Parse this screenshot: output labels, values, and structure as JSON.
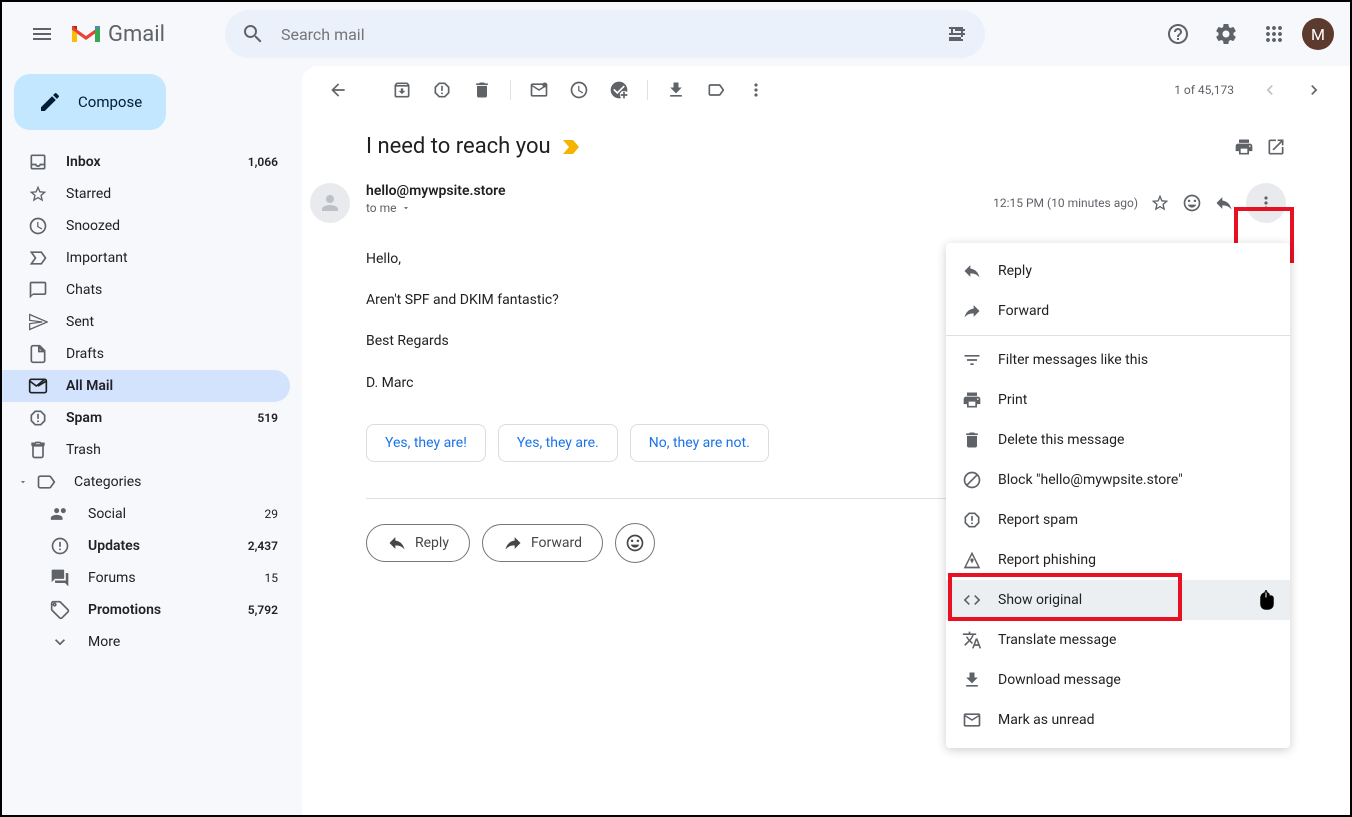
{
  "header": {
    "app_name": "Gmail",
    "search_placeholder": "Search mail",
    "avatar_letter": "M"
  },
  "sidebar": {
    "compose": "Compose",
    "items": [
      {
        "label": "Inbox",
        "count": "1,066",
        "bold": true
      },
      {
        "label": "Starred"
      },
      {
        "label": "Snoozed"
      },
      {
        "label": "Important"
      },
      {
        "label": "Chats"
      },
      {
        "label": "Sent"
      },
      {
        "label": "Drafts"
      },
      {
        "label": "All Mail",
        "active": true,
        "bold": true
      },
      {
        "label": "Spam",
        "count": "519",
        "bold": true
      },
      {
        "label": "Trash"
      },
      {
        "label": "Categories"
      },
      {
        "label": "Social",
        "count": "29",
        "sub": true
      },
      {
        "label": "Updates",
        "count": "2,437",
        "sub": true,
        "bold": true
      },
      {
        "label": "Forums",
        "count": "15",
        "sub": true
      },
      {
        "label": "Promotions",
        "count": "5,792",
        "sub": true,
        "bold": true
      },
      {
        "label": "More",
        "sub": true
      }
    ]
  },
  "toolbar": {
    "pager": "1 of 45,173"
  },
  "email": {
    "subject": "I need to reach you",
    "sender": "hello@mywpsite.store",
    "to": "to me",
    "time": "12:15 PM (10 minutes ago)",
    "body": {
      "line1": "Hello,",
      "line2": "Aren't SPF and DKIM fantastic?",
      "line3": "Best Regards",
      "line4": "D. Marc"
    },
    "smart_replies": [
      "Yes, they are!",
      "Yes, they are.",
      "No, they are not."
    ],
    "reply_label": "Reply",
    "forward_label": "Forward"
  },
  "menu": {
    "items": [
      {
        "label": "Reply"
      },
      {
        "label": "Forward"
      },
      {
        "sep": true
      },
      {
        "label": "Filter messages like this"
      },
      {
        "label": "Print"
      },
      {
        "label": "Delete this message"
      },
      {
        "label": "Block \"hello@mywpsite.store\""
      },
      {
        "label": "Report spam"
      },
      {
        "label": "Report phishing"
      },
      {
        "label": "Show original",
        "hovered": true
      },
      {
        "label": "Translate message"
      },
      {
        "label": "Download message"
      },
      {
        "label": "Mark as unread"
      }
    ]
  }
}
